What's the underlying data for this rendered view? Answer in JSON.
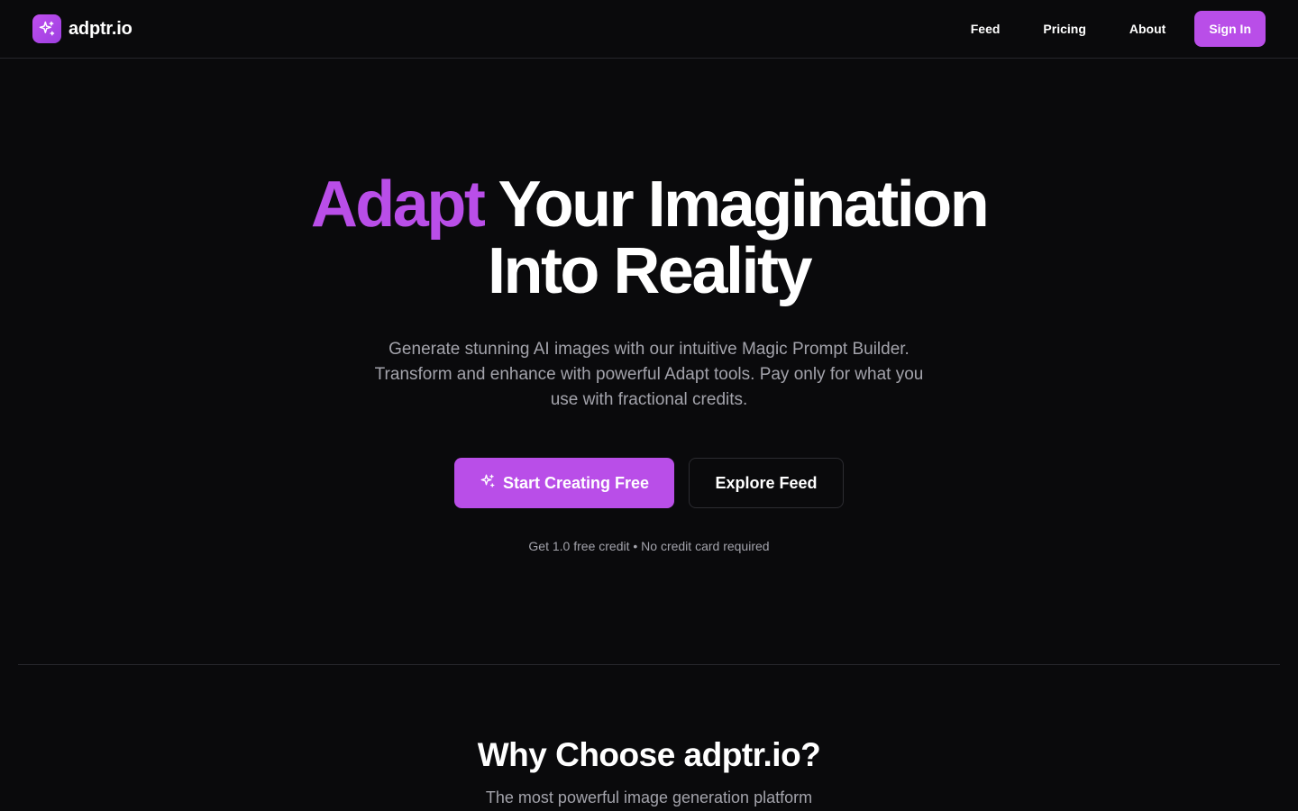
{
  "header": {
    "brand": "adptr.io",
    "logo_icon": "sparkles-icon",
    "nav": [
      "Feed",
      "Pricing",
      "About"
    ],
    "signin_label": "Sign In"
  },
  "hero": {
    "title_accent": "Adapt",
    "title_rest_line1": "Your Imagination",
    "title_line2": "Into Reality",
    "subtitle": "Generate stunning AI images with our intuitive Magic Prompt Builder. Transform and enhance with powerful Adapt tools. Pay only for what you use with fractional credits.",
    "primary_cta": "Start Creating Free",
    "secondary_cta": "Explore Feed",
    "note": "Get 1.0 free credit • No credit card required"
  },
  "why": {
    "title": "Why Choose adptr.io?",
    "subtitle": "The most powerful image generation platform"
  },
  "colors": {
    "background": "#0a0a0c",
    "accent": "#b94ee8",
    "muted_text": "#a3a3ab",
    "border": "#26262b"
  }
}
